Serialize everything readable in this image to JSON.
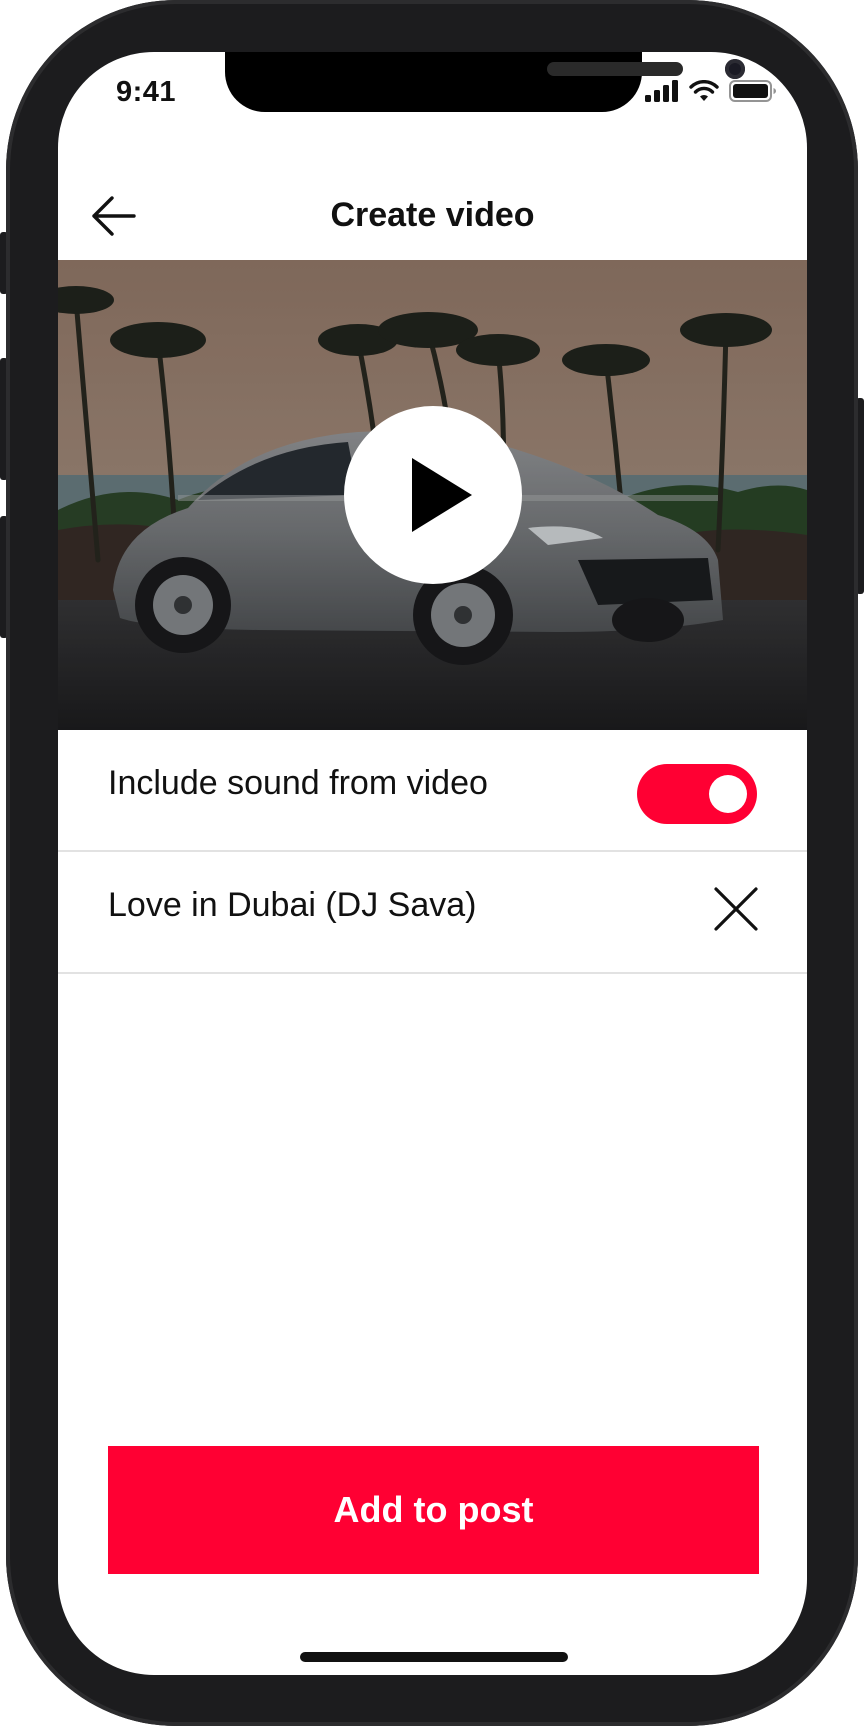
{
  "colors": {
    "accent": "#FF0033",
    "text": "#111111",
    "divider": "#E2E2E2",
    "background": "#FFFFFF"
  },
  "status_bar": {
    "time": "9:41",
    "icons": [
      "signal-icon",
      "wifi-icon",
      "battery-icon"
    ]
  },
  "header": {
    "back_icon": "arrow-left-icon",
    "title": "Create video"
  },
  "video": {
    "play_icon": "play-icon"
  },
  "settings": {
    "include_sound": {
      "label": "Include sound from video",
      "enabled": true
    },
    "music_track": {
      "label": "Love in Dubai (DJ Sava)",
      "remove_icon": "close-icon"
    }
  },
  "actions": {
    "add_to_post_label": "Add to post"
  }
}
